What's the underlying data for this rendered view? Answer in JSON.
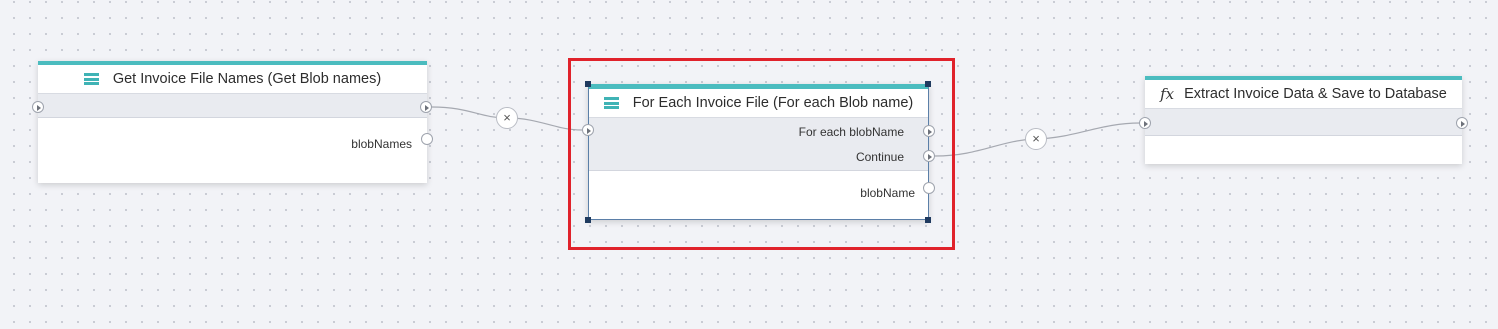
{
  "canvas": {
    "background": "#f2f3f7",
    "accent_color": "#4bbcbf",
    "selection_color": "#e0222b"
  },
  "nodes": [
    {
      "id": "get-invoice",
      "icon": "stack-icon",
      "title": "Get Invoice File Names (Get Blob names)",
      "outputs": [
        "blobNames"
      ]
    },
    {
      "id": "for-each",
      "icon": "stack-icon",
      "title": "For Each Invoice File (For each Blob name)",
      "flow_outcomes": [
        "For each blobName",
        "Continue"
      ],
      "outputs": [
        "blobName"
      ],
      "selected": true
    },
    {
      "id": "extract",
      "icon": "fx-icon",
      "icon_text": "fx",
      "title": "Extract Invoice Data & Save to Database"
    }
  ],
  "connections": [
    {
      "from": "get-invoice",
      "to": "for-each",
      "remove_glyph": "×"
    },
    {
      "from": "for-each:Continue",
      "to": "extract",
      "remove_glyph": "×"
    }
  ]
}
